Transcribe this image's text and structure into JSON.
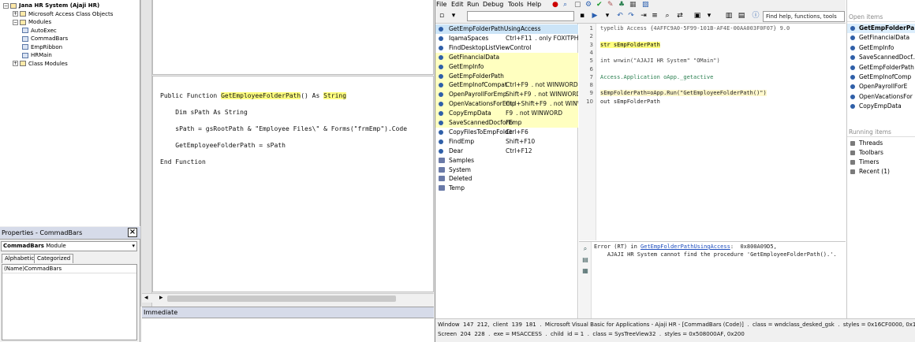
{
  "vbe": {
    "project_tree": [
      {
        "label": "Jana HR System (Ajaji HR)",
        "level": 0,
        "kind": "project"
      },
      {
        "label": "Microsoft Access Class Objects",
        "level": 1,
        "kind": "folder"
      },
      {
        "label": "Modules",
        "level": 1,
        "kind": "folder"
      },
      {
        "label": "AutoExec",
        "level": 2,
        "kind": "module"
      },
      {
        "label": "CommadBars",
        "level": 2,
        "kind": "module"
      },
      {
        "label": "EmpRibbon",
        "level": 2,
        "kind": "module"
      },
      {
        "label": "HRMain",
        "level": 2,
        "kind": "module"
      },
      {
        "label": "Class Modules",
        "level": 1,
        "kind": "folder"
      }
    ],
    "properties": {
      "title": "Properties - CommadBars",
      "object_name": "CommadBars",
      "object_type": "Module",
      "tabs": [
        "Alphabetic",
        "Categorized"
      ],
      "rows": [
        {
          "name": "(Name)",
          "value": "CommadBars"
        }
      ]
    },
    "code_lines": [
      {
        "pre": "Public Function ",
        "hl1": "GetEmployeeFolderPath",
        "mid": "() As ",
        "hl2": "String",
        "post": ""
      },
      {
        "pre": "    Dim sPath As String",
        "hl1": "",
        "mid": "",
        "hl2": "",
        "post": ""
      },
      {
        "pre": "    sPath = gsRootPath & \"Employee Files\\\" & Forms(\"frmEmp\").Code",
        "hl1": "",
        "mid": "",
        "hl2": "",
        "post": ""
      },
      {
        "pre": "    GetEmployeeFolderPath = sPath",
        "hl1": "",
        "mid": "",
        "hl2": "",
        "post": ""
      },
      {
        "pre": "End Function",
        "hl1": "",
        "mid": "",
        "hl2": "",
        "post": ""
      }
    ],
    "immediate_title": "Immediate"
  },
  "ide": {
    "menu": [
      "File",
      "Edit",
      "Run",
      "Debug",
      "Tools",
      "Help"
    ],
    "help_search_placeholder": "Find help, functions, tools",
    "functions": [
      {
        "name": "GetEmpFolderPathUsingAccess",
        "shortcut": "",
        "note": "",
        "icon": "func",
        "style": "sel"
      },
      {
        "name": "IqamaSpaces",
        "shortcut": "Ctrl+F11",
        "note": ". only FOXITPHANTOM",
        "icon": "func",
        "style": ""
      },
      {
        "name": "FindDesktopListViewControl",
        "shortcut": "",
        "note": "",
        "icon": "func",
        "style": ""
      },
      {
        "name": "GetFinancialData",
        "shortcut": "",
        "note": "",
        "icon": "func",
        "style": "yellow"
      },
      {
        "name": "GetEmpInfo",
        "shortcut": "",
        "note": "",
        "icon": "func",
        "style": "yellow"
      },
      {
        "name": "GetEmpFolderPath",
        "shortcut": "",
        "note": "",
        "icon": "func",
        "style": "yellow"
      },
      {
        "name": "GetEmpInofCompat",
        "shortcut": "Ctrl+F9",
        "note": ". not WINWORD",
        "icon": "func",
        "style": "yellow"
      },
      {
        "name": "OpenPayrollForEmp",
        "shortcut": "Shift+F9",
        "note": ". not WINWORD",
        "icon": "func",
        "style": "yellow"
      },
      {
        "name": "OpenVacationsForEmp",
        "shortcut": "Ctrl+Shift+F9",
        "note": ". not WINWORD",
        "icon": "func",
        "style": "yellow"
      },
      {
        "name": "CopyEmpData",
        "shortcut": "F9",
        "note": ". not WINWORD",
        "icon": "func",
        "style": "yellow"
      },
      {
        "name": "SaveScannedDocforEmp",
        "shortcut": "F6",
        "note": "",
        "icon": "func",
        "style": "yellow"
      },
      {
        "name": "CopyFilesToEmpFolder",
        "shortcut": "Ctrl+F6",
        "note": "",
        "icon": "func",
        "style": ""
      },
      {
        "name": "FindEmp",
        "shortcut": "Shift+F10",
        "note": "",
        "icon": "func",
        "style": ""
      },
      {
        "name": "Dear",
        "shortcut": "Ctrl+F12",
        "note": "",
        "icon": "func",
        "style": ""
      },
      {
        "name": "Samples",
        "shortcut": "",
        "note": "",
        "icon": "folder",
        "style": ""
      },
      {
        "name": "System",
        "shortcut": "",
        "note": "",
        "icon": "folder",
        "style": ""
      },
      {
        "name": "Deleted",
        "shortcut": "",
        "note": "",
        "icon": "folder",
        "style": ""
      },
      {
        "name": "Temp",
        "shortcut": "",
        "note": "",
        "icon": "folder",
        "style": ""
      }
    ],
    "editor_lines": [
      {
        "n": "1",
        "text": "typelib Access {4AFFC9A0-5F99-101B-AF4E-00AA003F0F07} 9.0"
      },
      {
        "n": "2",
        "text": ""
      },
      {
        "n": "3",
        "text": "str sEmpFolderPath"
      },
      {
        "n": "4",
        "text": ""
      },
      {
        "n": "5",
        "text": "int w=win(\"AJAJI HR System\" \"OMain\")"
      },
      {
        "n": "6",
        "text": ""
      },
      {
        "n": "7",
        "text": "Access.Application oApp._getactive"
      },
      {
        "n": "8",
        "text": ""
      },
      {
        "n": "9",
        "text": "sEmpFolderPath=oApp.Run(\"GetEmployeeFolderPath()\")"
      },
      {
        "n": "10",
        "text": "out sEmpFolderPath"
      }
    ],
    "output": {
      "line1_prefix": "Error (RT) in ",
      "line1_link": "GetEmpFolderPathUsingAccess",
      "line1_suffix": ":  0x800A09D5,",
      "line2": "    AJAJI HR System cannot find the procedure 'GetEmployeeFolderPath().'.",
      "line2_link": "?"
    },
    "open_items_title": "Open items",
    "open_items": [
      "GetEmpFolderPa...",
      "GetFinancialData",
      "GetEmpInfo",
      "SaveScannedDocf...",
      "GetEmpFolderPath",
      "GetEmpInofComp",
      "OpenPayrollForE",
      "OpenVacationsFor",
      "CopyEmpData"
    ],
    "running_items_title": "Running items",
    "running_items": [
      "Threads",
      "Toolbars",
      "Timers",
      "Recent (1)"
    ],
    "status_line1": "Window  147  212,  client  139  181  .  Microsoft Visual Basic for Applications - Ajaji HR - [CommadBars (Code)]  .  class = wndclass_desked_gsk  .  styles = 0x16CF0000, 0x100",
    "status_line2": "Screen  204  228  .  exe = MSACCESS  .  child  id = 1  .  class = SysTreeView32  .  styles = 0x508000AF, 0x200"
  },
  "colors": {
    "highlight": "#ffff80",
    "yellow_row": "#ffffc0",
    "selection": "#cce4f7",
    "link": "#1f4fbf"
  }
}
